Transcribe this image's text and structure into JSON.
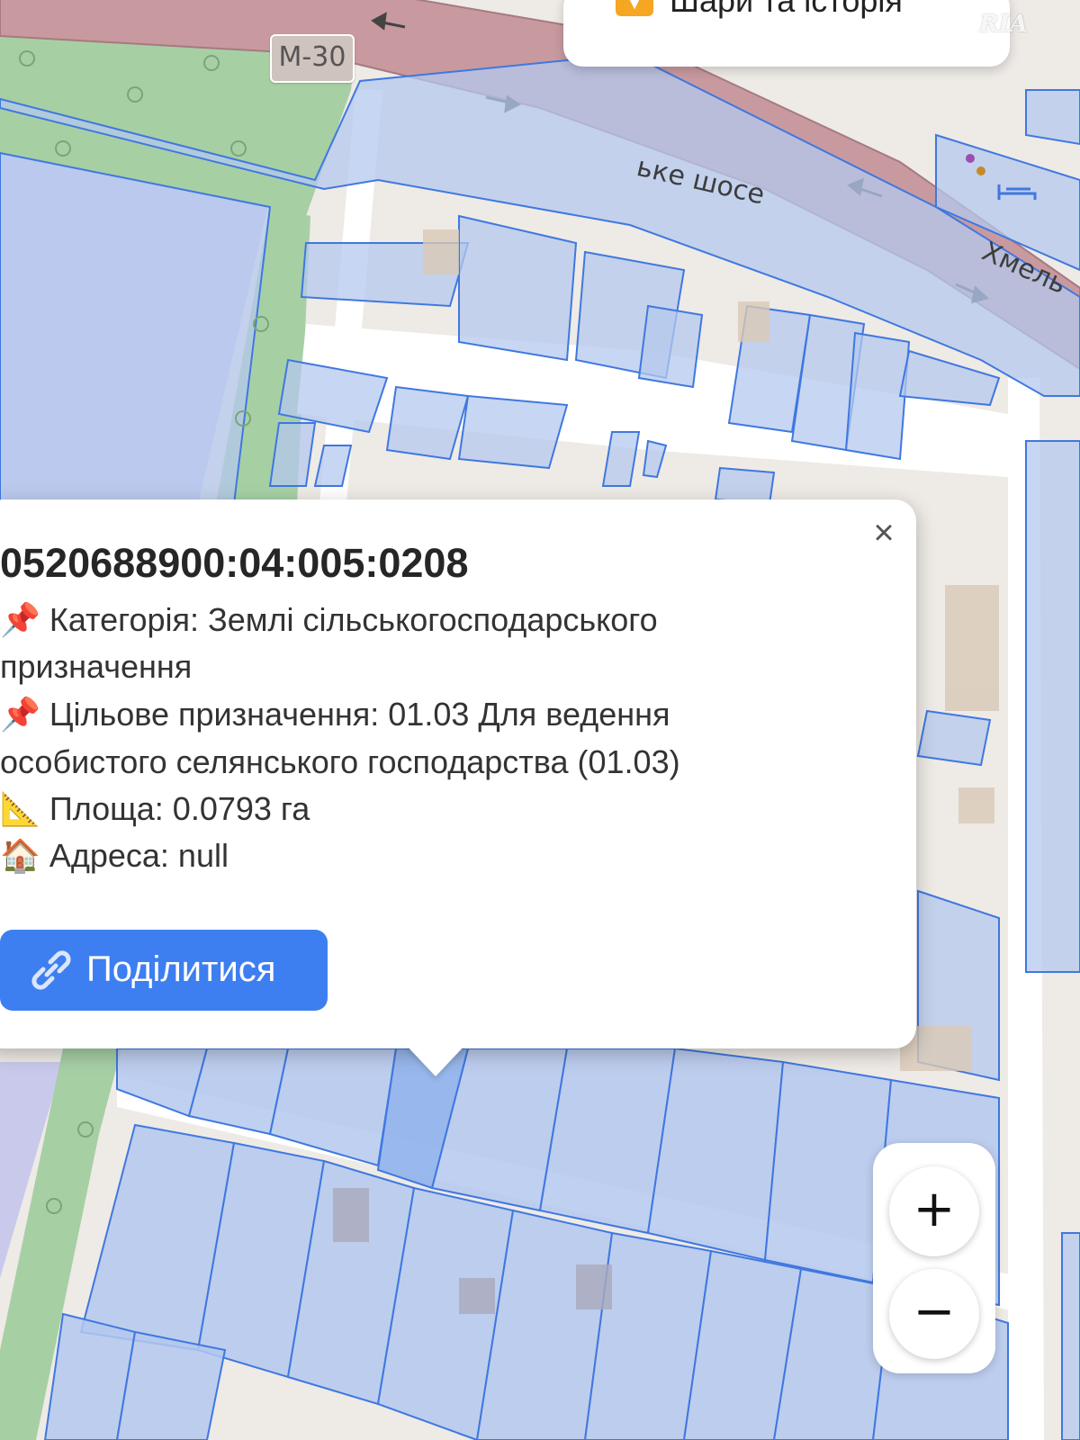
{
  "map": {
    "route_shield": "M-30",
    "road_label_left": "ьке шосе",
    "road_label_right": "Хмель",
    "colors": {
      "road": "#c89a9f",
      "road_border": "#a77",
      "parcel_fill": "#b4c8ee",
      "parcel_stroke": "#3f78e0",
      "forest": "#a7cfa4",
      "purple_zone": "#c9c9ec",
      "highlight": "#8eb1ec"
    }
  },
  "layers_button": {
    "icon": "chevron-down-icon",
    "label": "Шари та історія"
  },
  "watermark": "RIA",
  "popup": {
    "parcel_id": "0520688900:04:005:0208",
    "lines": [
      {
        "icon": "pushpin-icon",
        "emoji": "📌",
        "text": "Категорія: Землі сільськогосподарського"
      },
      {
        "icon": "",
        "emoji": "",
        "text": "призначення"
      },
      {
        "icon": "pushpin-icon",
        "emoji": "📌",
        "text": "Цільове призначення: 01.03 Для ведення"
      },
      {
        "icon": "",
        "emoji": "",
        "text": "особистого селянського господарства (01.03)"
      },
      {
        "icon": "triangular-ruler-icon",
        "emoji": "📐",
        "text": "Площа: 0.0793 га"
      },
      {
        "icon": "house-icon",
        "emoji": "🏠",
        "text": "Адреса: null"
      }
    ],
    "share_label": "Поділитися",
    "close_symbol": "×"
  },
  "zoom": {
    "in_label": "+",
    "out_label": "−"
  }
}
